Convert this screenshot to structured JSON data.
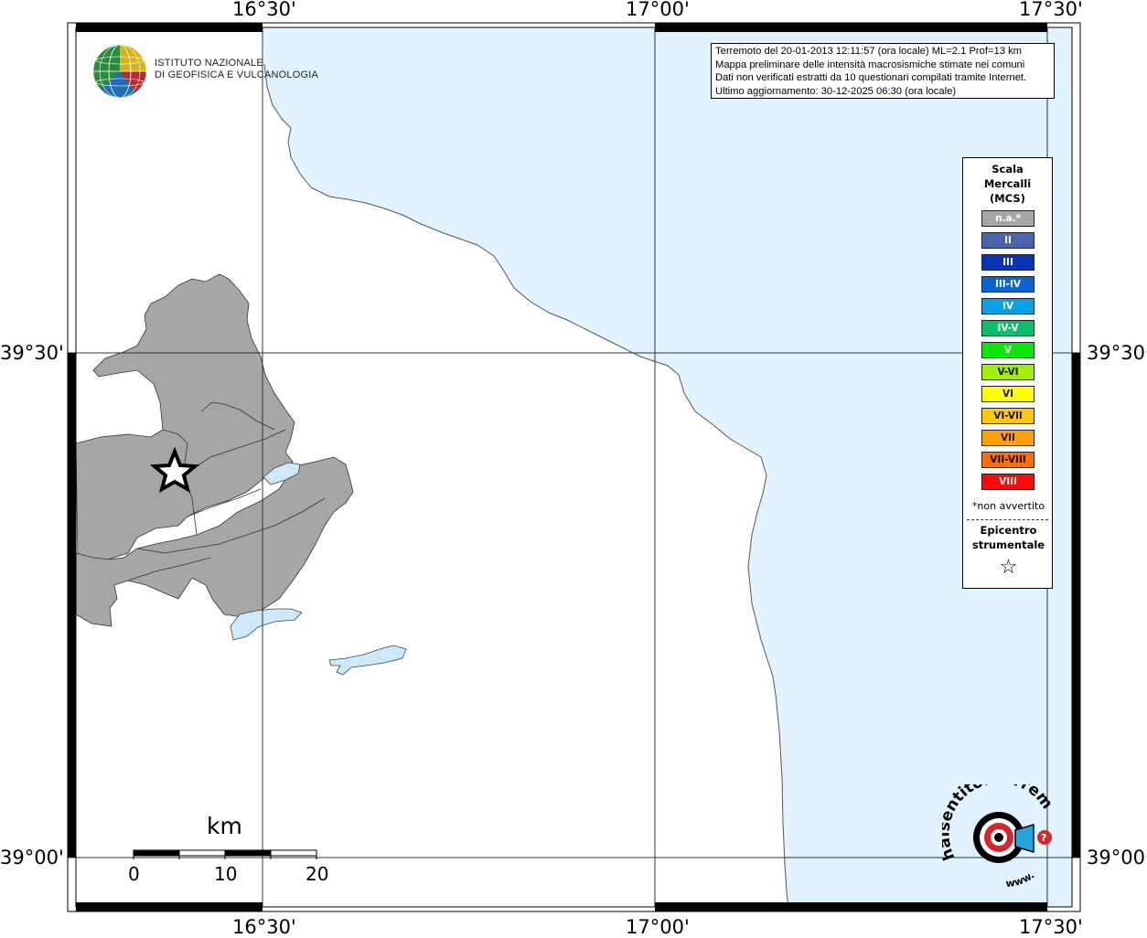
{
  "axes": {
    "lon_labels": [
      "16°30'",
      "17°00'",
      "17°30'"
    ],
    "lat_labels": [
      "39°30'",
      "39°00'"
    ]
  },
  "info": {
    "line1": "Terremoto del 20-01-2013 12:11:57 (ora locale) ML=2.1 Prof=13 km",
    "line2": "Mappa preliminare delle intensità macrosismiche stimate nei comuni",
    "line3": "Dati non verificati estratti da 10 questionari compilati tramite Internet.",
    "line4": "Ultimo aggiornamento: 30-12-2025 06:30 (ora locale)"
  },
  "logo": {
    "line1": "ISTITUTO NAZIONALE",
    "line2": "DI GEOFISICA E VULCANOLOGIA"
  },
  "legend": {
    "title1": "Scala",
    "title2": "Mercalli",
    "title3": "(MCS)",
    "items": [
      {
        "label": "n.a.*",
        "color": "#a6a6a6"
      },
      {
        "label": "II",
        "color": "#4a63ad"
      },
      {
        "label": "III",
        "color": "#0a32b4"
      },
      {
        "label": "III-IV",
        "color": "#0a64d2"
      },
      {
        "label": "IV",
        "color": "#0aa0e6"
      },
      {
        "label": "IV-V",
        "color": "#0abe6e"
      },
      {
        "label": "V",
        "color": "#0ae60a"
      },
      {
        "label": "V-VI",
        "color": "#a0ee0a"
      },
      {
        "label": "VI",
        "color": "#ffff0a"
      },
      {
        "label": "VI-VII",
        "color": "#ffc80a"
      },
      {
        "label": "VII",
        "color": "#ffa00a"
      },
      {
        "label": "VII-VIII",
        "color": "#ff6e0a"
      },
      {
        "label": "VIII",
        "color": "#ff0a0a"
      }
    ],
    "note": "*non avvertito",
    "epicentre1": "Epicentro",
    "epicentre2": "strumentale"
  },
  "scale": {
    "title": "km",
    "ticks": [
      "0",
      "10",
      "20"
    ]
  },
  "watermark": {
    "text": "haisentitoilterremoto.it",
    "url": "www."
  },
  "colors": {
    "sea": "#e1f3fe",
    "felt_area": "#a6a6a6",
    "lake": "#cde8f8"
  }
}
